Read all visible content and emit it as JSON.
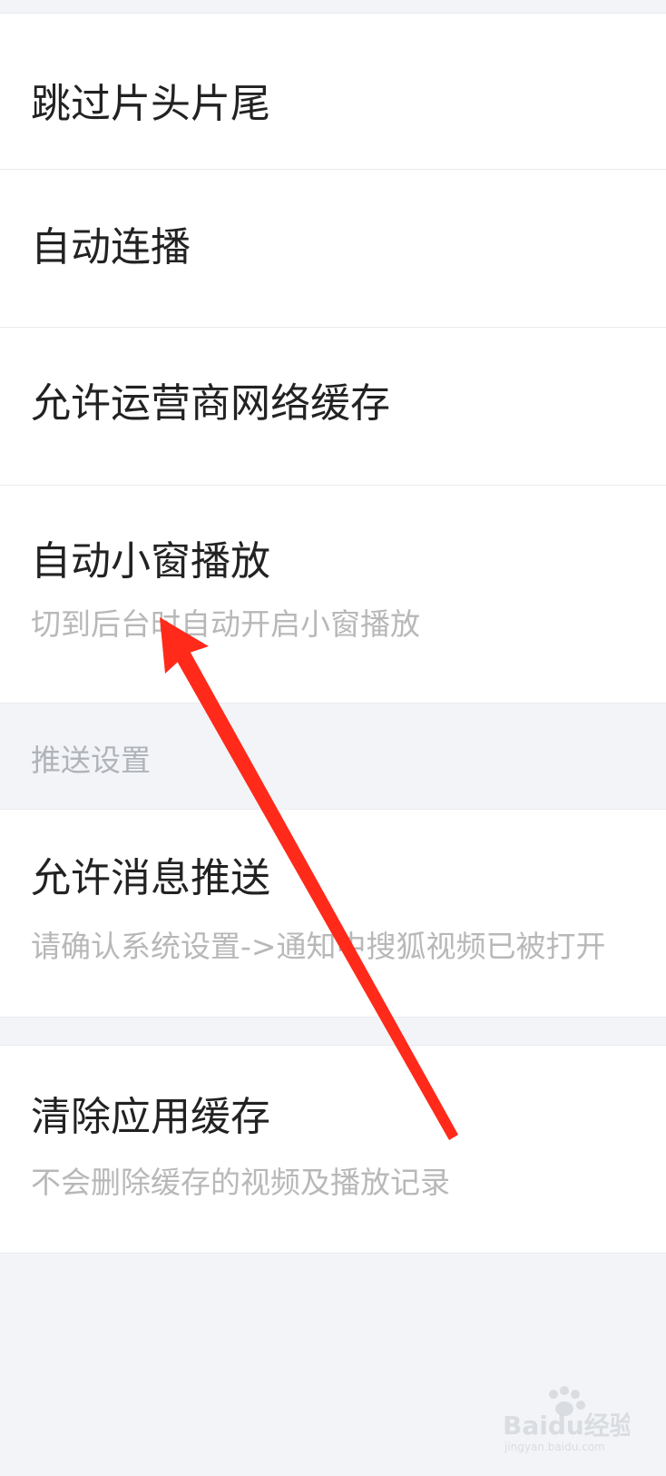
{
  "settings": {
    "rows": [
      {
        "title": "跳过片头片尾"
      },
      {
        "title": "自动连播"
      },
      {
        "title": "允许运营商网络缓存"
      },
      {
        "title": "自动小窗播放",
        "subtitle": "切到后台时自动开启小窗播放"
      }
    ],
    "push_section": {
      "header": "推送设置",
      "rows": [
        {
          "title": "允许消息推送",
          "subtitle": "请确认系统设置->通知中搜狐视频已被打开"
        }
      ]
    },
    "cache_row": {
      "title": "清除应用缓存",
      "subtitle": "不会删除缓存的视频及播放记录"
    }
  },
  "annotation": {
    "arrow_color": "#ff2a1a"
  },
  "watermark": {
    "brand": "Baidu经验",
    "url": "jingyan.baidu.com"
  }
}
